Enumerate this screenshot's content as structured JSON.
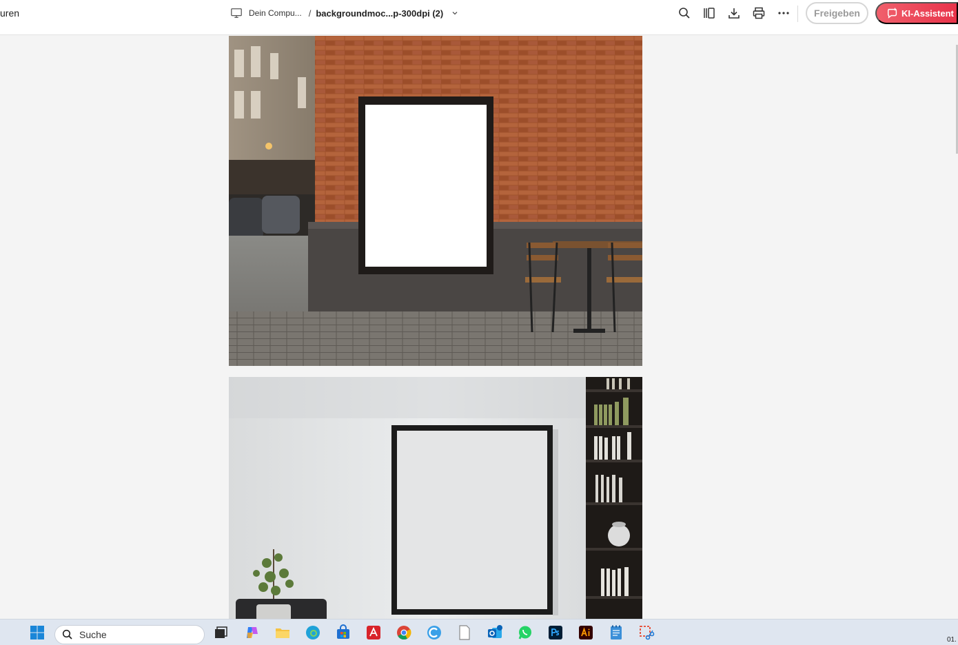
{
  "toolbar": {
    "left_label": "uren",
    "location": "Dein Compu...",
    "separator": "/",
    "filename": "backgroundmoc...p-300dpi (2)",
    "share_label": "Freigeben",
    "ai_label": "KI-Assistent",
    "icons": [
      "monitor-icon",
      "chevron-down-icon",
      "search-icon",
      "pages-icon",
      "download-icon",
      "print-icon",
      "more-icon",
      "ai-chat-icon"
    ],
    "accent_color": "#e8334a"
  },
  "document": {
    "pages": [
      {
        "name": "poster mockup on brick wall street cafe"
      },
      {
        "name": "frame mockup in living room with bookshelf"
      }
    ]
  },
  "taskbar": {
    "search_placeholder": "Suche",
    "clock_partial": "01.",
    "apps": [
      "windows-start-icon",
      "task-view-icon",
      "copilot-icon",
      "file-explorer-icon",
      "edge-icon",
      "ms-store-icon",
      "acrobat-icon",
      "chrome-icon",
      "c-app-icon",
      "blank-file-icon",
      "outlook-icon",
      "whatsapp-icon",
      "photoshop-icon",
      "illustrator-icon",
      "notepad-icon",
      "snipping-tool-icon"
    ]
  }
}
